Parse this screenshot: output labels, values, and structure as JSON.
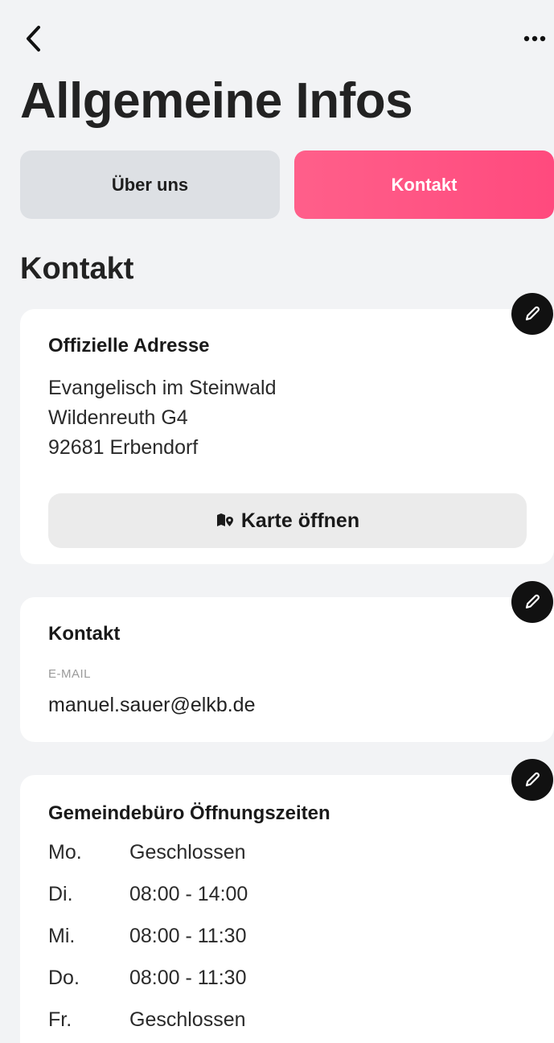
{
  "header": {
    "back_icon": "chevron-left-icon",
    "more_icon": "ellipsis-icon",
    "title": "Allgemeine Infos"
  },
  "tabs": [
    {
      "label": "Über uns",
      "active": false
    },
    {
      "label": "Kontakt",
      "active": true
    }
  ],
  "colors": {
    "accent": "#ff4f82",
    "background": "#f2f3f5",
    "card": "#ffffff",
    "edit_button": "#111111"
  },
  "section_heading": "Kontakt",
  "address_card": {
    "title": "Offizielle Adresse",
    "lines": [
      "Evangelisch im Steinwald",
      "Wildenreuth G4",
      "92681 Erbendorf"
    ],
    "map_button_label": "Karte öffnen",
    "map_icon": "map-pin-icon",
    "edit_icon": "pencil-icon"
  },
  "contact_card": {
    "title": "Kontakt",
    "email_label": "E-MAIL",
    "email_value": "manuel.sauer@elkb.de",
    "edit_icon": "pencil-icon"
  },
  "hours_card": {
    "title": "Gemeindebüro Öffnungszeiten",
    "rows": [
      {
        "day": "Mo.",
        "time": "Geschlossen"
      },
      {
        "day": "Di.",
        "time": "08:00 - 14:00"
      },
      {
        "day": "Mi.",
        "time": "08:00 - 11:30"
      },
      {
        "day": "Do.",
        "time": "08:00 - 11:30"
      },
      {
        "day": "Fr.",
        "time": "Geschlossen"
      }
    ],
    "edit_icon": "pencil-icon"
  }
}
